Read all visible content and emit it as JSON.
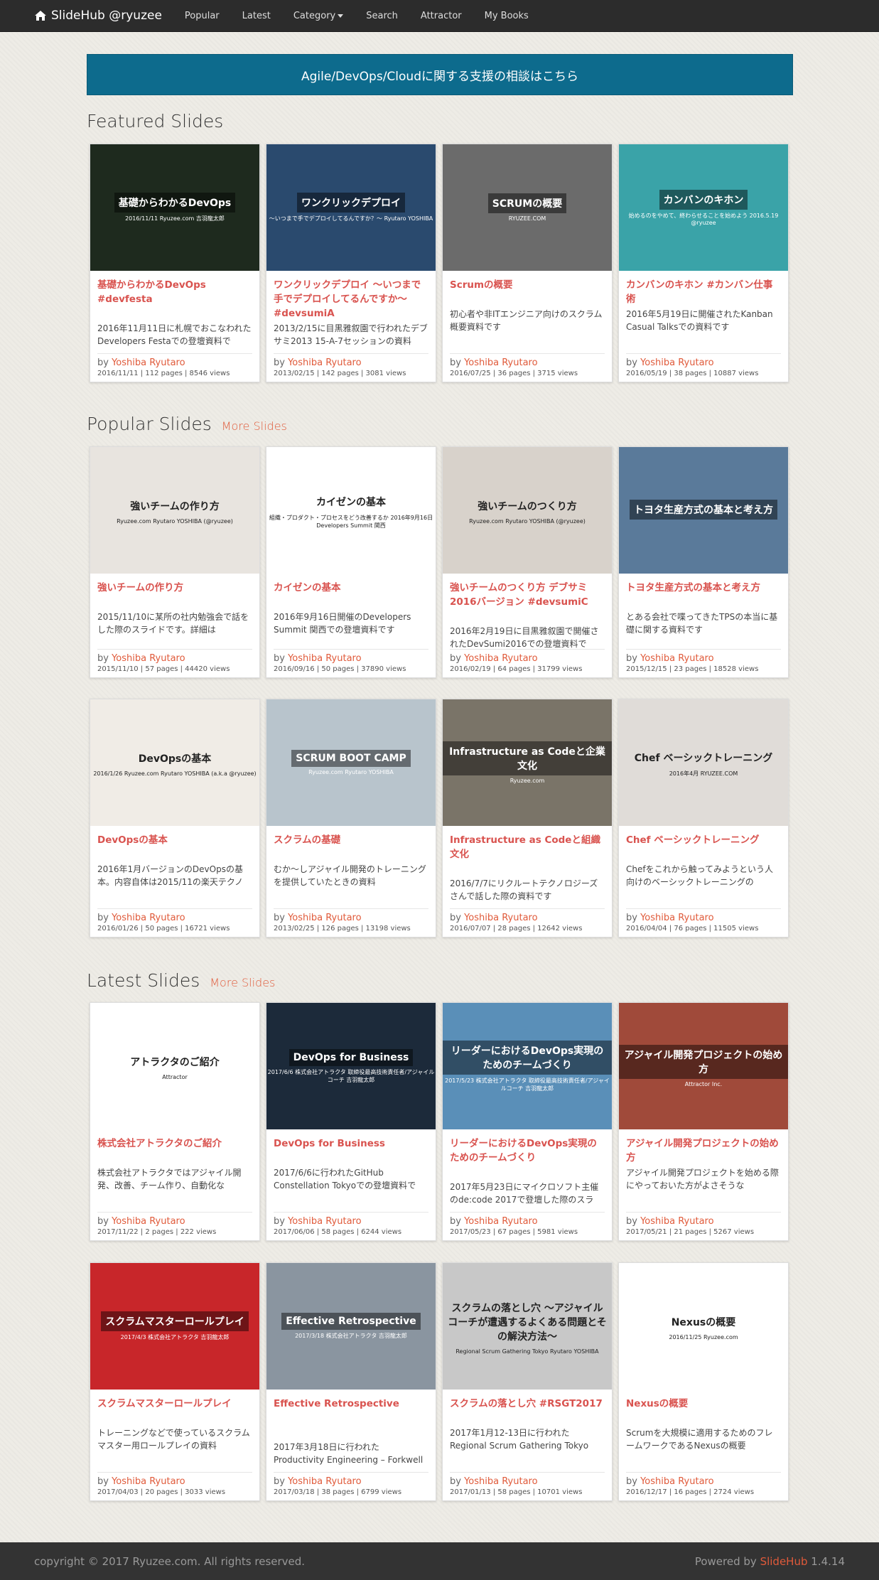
{
  "nav": {
    "brand": "SlideHub @ryuzee",
    "items": [
      "Popular",
      "Latest",
      "Category",
      "Search",
      "Attractor",
      "My Books"
    ]
  },
  "banner": "Agile/DevOps/Cloudに関する支援の相談はこちら",
  "featured": {
    "title": "Featured Slides",
    "cards": [
      {
        "title": "基礎からわかるDevOps #devfesta",
        "desc": "2016年11月11日に札幌でおこなわれたDevelopers Festaでの登壇資料で",
        "author": "Yoshiba Ryutaro",
        "meta": "2016/11/11 | 112 pages | 8546 views",
        "thumb_title": "基礎からわかるDevOps",
        "thumb_sub": "2016/11/11 Ryuzee.com 吉羽龍太郎",
        "bg": "#1e2a1e"
      },
      {
        "title": "ワンクリックデプロイ 〜いつまで手でデプロイしてるんですか〜 #devsumiA",
        "desc": "2013/2/15に目黒雅叙園で行われたデブサミ2013 15-A-7セッションの資料",
        "author": "Yoshiba Ryutaro",
        "meta": "2013/02/15 | 142 pages | 3081 views",
        "thumb_title": "ワンクリックデプロイ",
        "thumb_sub": "〜いつまで手でデプロイしてるんですか？〜  Ryutaro YOSHIBA",
        "bg": "#2a4a6e"
      },
      {
        "title": "Scrumの概要",
        "desc": "初心者や非ITエンジニア向けのスクラム概要資料です",
        "author": "Yoshiba Ryutaro",
        "meta": "2016/07/25 | 36 pages | 3715 views",
        "thumb_title": "SCRUMの概要",
        "thumb_sub": "RYUZEE.COM",
        "bg": "#6b6b6b"
      },
      {
        "title": "カンバンのキホン #カンバン仕事術",
        "desc": "2016年5月19日に開催されたKanban Casual Talksでの資料です",
        "author": "Yoshiba Ryutaro",
        "meta": "2016/05/19 | 38 pages | 10887 views",
        "thumb_title": "カンバンのキホン",
        "thumb_sub": "始めるのをやめて、終わらせることを始めよう  2016.5.19 @ryuzee",
        "bg": "#3aa3a8"
      }
    ]
  },
  "popular": {
    "title": "Popular Slides",
    "more": "More Slides",
    "cards": [
      {
        "title": "強いチームの作り方",
        "desc": "2015/11/10に某所の社内勉強会で話をした際のスライドです。詳細は",
        "author": "Yoshiba Ryutaro",
        "meta": "2015/11/10 | 57 pages | 44420 views",
        "thumb_title": "強いチームの作り方",
        "thumb_sub": "Ryuzee.com Ryutaro YOSHIBA (@ryuzee)",
        "bg": "#e8e4df"
      },
      {
        "title": "カイゼンの基本",
        "desc": "2016年9月16日開催のDevelopers Summit 関西での登壇資料です",
        "author": "Yoshiba Ryutaro",
        "meta": "2016/09/16 | 50 pages | 37890 views",
        "thumb_title": "カイゼンの基本",
        "thumb_sub": "組織・プロダクト・プロセスをどう改善するか 2016年9月16日 Developers Summit 関西",
        "bg": "#ffffff"
      },
      {
        "title": "強いチームのつくり方 デブサミ2016バージョン #devsumiC",
        "desc": "2016年2月19日に目黒雅叙園で開催されたDevSumi2016での登壇資料で",
        "author": "Yoshiba Ryutaro",
        "meta": "2016/02/19 | 64 pages | 31799 views",
        "thumb_title": "強いチームのつくり方",
        "thumb_sub": "Ryuzee.com Ryutaro YOSHIBA (@ryuzee)",
        "bg": "#d8d2cb"
      },
      {
        "title": "トヨタ生産方式の基本と考え方",
        "desc": "とある会社で喋ってきたTPSの本当に基礎に関する資料です",
        "author": "Yoshiba Ryutaro",
        "meta": "2015/12/15 | 23 pages | 18528 views",
        "thumb_title": "トヨタ生産方式の基本と考え方",
        "thumb_sub": "",
        "bg": "#5a7a9a"
      },
      {
        "title": "DevOpsの基本",
        "desc": "2016年1月バージョンのDevOpsの基本。内容自体は2015/11の楽天テクノ",
        "author": "Yoshiba Ryutaro",
        "meta": "2016/01/26 | 50 pages | 16721 views",
        "thumb_title": "DevOpsの基本",
        "thumb_sub": "2016/1/26 Ryuzee.com Ryutaro YOSHIBA (a.k.a @ryuzee)",
        "bg": "#f0ece6"
      },
      {
        "title": "スクラムの基礎",
        "desc": "むか〜しアジャイル開発のトレーニングを提供していたときの資料",
        "author": "Yoshiba Ryutaro",
        "meta": "2013/02/25 | 126 pages | 13198 views",
        "thumb_title": "SCRUM BOOT CAMP",
        "thumb_sub": "Ryuzee.com Ryutaro YOSHIBA",
        "bg": "#b8c4cc"
      },
      {
        "title": "Infrastructure as Codeと組織文化",
        "desc": "2016/7/7にリクルートテクノロジーズさんで話した際の資料です",
        "author": "Yoshiba Ryutaro",
        "meta": "2016/07/07 | 28 pages | 12642 views",
        "thumb_title": "Infrastructure as Codeと企業文化",
        "thumb_sub": "Ryuzee.com",
        "bg": "#7a7468"
      },
      {
        "title": "Chef ベーシックトレーニング",
        "desc": "Chefをこれから触ってみようという人向けのベーシックトレーニングの",
        "author": "Yoshiba Ryutaro",
        "meta": "2016/04/04 | 76 pages | 11505 views",
        "thumb_title": "Chef ベーシックトレーニング",
        "thumb_sub": "2016年4月 RYUZEE.COM",
        "bg": "#e0dcd8"
      }
    ]
  },
  "latest": {
    "title": "Latest Slides",
    "more": "More Slides",
    "cards": [
      {
        "title": "株式会社アトラクタのご紹介",
        "desc": "株式会社アトラクタではアジャイル開発、改善、チーム作り、自動化な",
        "author": "Yoshiba Ryutaro",
        "meta": "2017/11/22 | 2 pages | 222 views",
        "thumb_title": "アトラクタのご紹介",
        "thumb_sub": "Attractor",
        "bg": "#ffffff"
      },
      {
        "title": "DevOps for Business",
        "desc": "2017/6/6に行われたGitHub Constellation Tokyoでの登壇資料で",
        "author": "Yoshiba Ryutaro",
        "meta": "2017/06/06 | 58 pages | 6244 views",
        "thumb_title": "DevOps for Business",
        "thumb_sub": "2017/6/6 株式会社アトラクタ 取締役最高技術責任者/アジャイルコーチ 吉羽龍太郎",
        "bg": "#1c2a3a"
      },
      {
        "title": "リーダーにおけるDevOps実現のためのチームづくり",
        "desc": "2017年5月23日にマイクロソフト主催のde:code 2017で登壇した際のスラ",
        "author": "Yoshiba Ryutaro",
        "meta": "2017/05/23 | 67 pages | 5981 views",
        "thumb_title": "リーダーにおけるDevOps実現のためのチームづくり",
        "thumb_sub": "2017/5/23 株式会社アトラクタ 取締役最高技術責任者/アジャイルコーチ 吉羽龍太郎",
        "bg": "#5a8fb8"
      },
      {
        "title": "アジャイル開発プロジェクトの始め方",
        "desc": "アジャイル開発プロジェクトを始める際にやっておいた方がよさそうな",
        "author": "Yoshiba Ryutaro",
        "meta": "2017/05/21 | 21 pages | 5267 views",
        "thumb_title": "アジャイル開発プロジェクトの始め方",
        "thumb_sub": "Attractor Inc.",
        "bg": "#a04a3a"
      },
      {
        "title": "スクラムマスターロールプレイ",
        "desc": "トレーニングなどで使っているスクラムマスター用ロールプレイの資料",
        "author": "Yoshiba Ryutaro",
        "meta": "2017/04/03 | 20 pages | 3033 views",
        "thumb_title": "スクラムマスターロールプレイ",
        "thumb_sub": "2017/4/3 株式会社アトラクタ 吉羽龍太郎",
        "bg": "#c8262a"
      },
      {
        "title": "Effective Retrospective",
        "desc": "2017年3月18日に行われたProductivity Engineering – Forkwell",
        "author": "Yoshiba Ryutaro",
        "meta": "2017/03/18 | 38 pages | 6799 views",
        "thumb_title": "Effective Retrospective",
        "thumb_sub": "2017/3/18 株式会社アトラクタ 吉羽龍太郎",
        "bg": "#8a95a0"
      },
      {
        "title": "スクラムの落とし穴 #RSGT2017",
        "desc": "2017年1月12-13日に行われたRegional Scrum Gathering Tokyo",
        "author": "Yoshiba Ryutaro",
        "meta": "2017/01/13 | 58 pages | 10701 views",
        "thumb_title": "スクラムの落とし穴 〜アジャイルコーチが遭遇するよくある問題とその解決方法〜",
        "thumb_sub": "Regional Scrum Gathering Tokyo  Ryutaro YOSHIBA",
        "bg": "#c8c8c8"
      },
      {
        "title": "Nexusの概要",
        "desc": "Scrumを大規模に適用するためのフレームワークであるNexusの概要",
        "author": "Yoshiba Ryutaro",
        "meta": "2016/12/17 | 16 pages | 2724 views",
        "thumb_title": "Nexusの概要",
        "thumb_sub": "2016/11/25 Ryuzee.com",
        "bg": "#ffffff"
      }
    ]
  },
  "by_label": "by",
  "footer": {
    "copyright": "copyright © 2017 Ryuzee.com. All rights reserved.",
    "powered_prefix": "Powered by",
    "powered_name": "SlideHub",
    "version": "1.4.14"
  },
  "colors": {
    "accent": "#e05a3a",
    "banner": "#0d6b8d",
    "navbar": "#2c2c2c"
  }
}
